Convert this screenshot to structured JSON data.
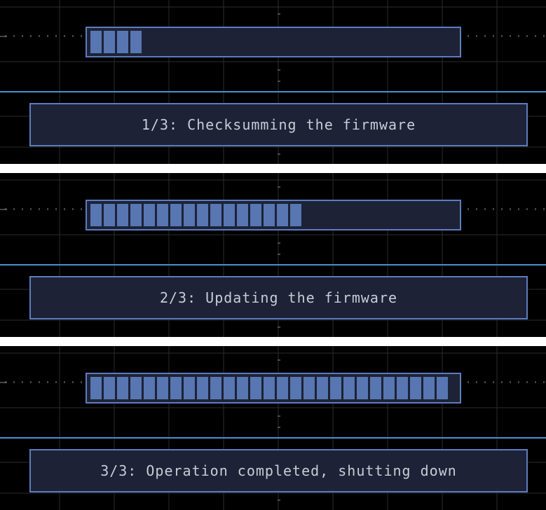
{
  "colors": {
    "background": "#000000",
    "box_fill": "#1d2236",
    "box_border": "#5d7cbf",
    "segment": "#5776b2",
    "text": "#c9ccd6",
    "divider": "#4a8fd0",
    "grid": "#2c2c2c",
    "dots": "#8a8a8a"
  },
  "steps": [
    {
      "message": "1/3: Checksumming the firmware",
      "progress_segments": 4,
      "total_segments": 27
    },
    {
      "message": "2/3: Updating the firmware",
      "progress_segments": 16,
      "total_segments": 27
    },
    {
      "message": "3/3: Operation completed, shutting down",
      "progress_segments": 27,
      "total_segments": 27
    }
  ]
}
